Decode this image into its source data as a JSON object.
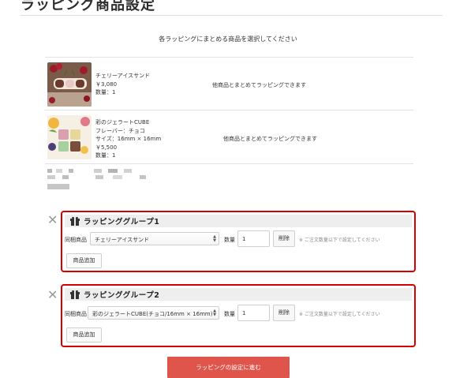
{
  "page": {
    "title": "ラッピング商品設定",
    "instruction": "各ラッピングにまとめる商品を選択してください"
  },
  "products": [
    {
      "image": "cherry-ice-sandwich-photo",
      "lines": [
        "チェリーアイスサンド",
        "￥3,080",
        "数量：1"
      ],
      "note": "他商品とまとめてラッピングできます"
    },
    {
      "image": "gelato-cube-photo",
      "lines": [
        "彩のジェラートCUBE",
        "フレーバー：チョコ",
        "サイズ：16mm × 16mm",
        "￥5,500",
        "数量：1"
      ],
      "note": "他商品とまとめてラッピングできます"
    }
  ],
  "groups": [
    {
      "title": "ラッピンググループ1",
      "product_label": "同梱商品",
      "selected_product": "チェリーアイスサンド",
      "quantity_label": "数量",
      "quantity": "1",
      "delete_label": "削除",
      "hint": "※ ご注文数量以下で設定してください",
      "add_label": "商品追加"
    },
    {
      "title": "ラッピンググループ2",
      "product_label": "同梱商品",
      "selected_product": "彩のジェラートCUBE(チョコ/16mm × 16mm)",
      "quantity_label": "数量",
      "quantity": "1",
      "delete_label": "削除",
      "hint": "※ ご注文数量以下で設定してください",
      "add_label": "商品追加"
    }
  ],
  "actions": {
    "proceed_label": "ラッピングの設定に進む"
  },
  "colors": {
    "highlight_border": "#d60000",
    "proceed_button": "#e0554b",
    "group_header_bg": "#eeeeee"
  }
}
